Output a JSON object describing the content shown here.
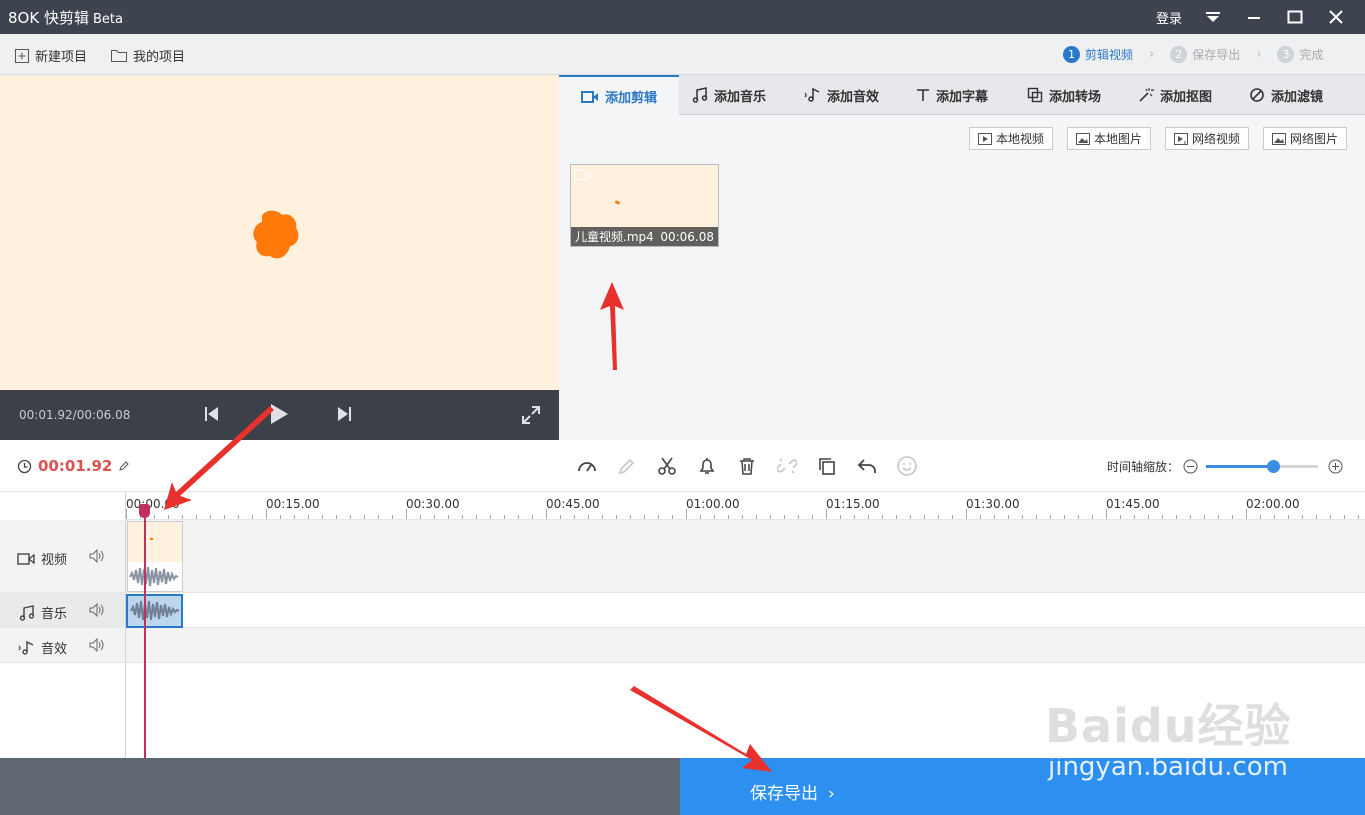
{
  "app": {
    "title": "快剪辑",
    "beta": "Beta",
    "logo_mark": "8OK"
  },
  "window": {
    "login": "登录"
  },
  "toolbar": {
    "new_project": "新建项目",
    "my_projects": "我的项目"
  },
  "steps": [
    {
      "num": "1",
      "label": "剪辑视频",
      "active": true
    },
    {
      "num": "2",
      "label": "保存导出",
      "active": false
    },
    {
      "num": "3",
      "label": "完成",
      "active": false
    }
  ],
  "player": {
    "timecode": "00:01.92/00:06.08"
  },
  "tabs": [
    {
      "label": "添加剪辑",
      "icon": "video-camera-icon",
      "active": true
    },
    {
      "label": "添加音乐",
      "icon": "music-note-icon"
    },
    {
      "label": "添加音效",
      "icon": "sound-effect-icon"
    },
    {
      "label": "添加字幕",
      "icon": "text-icon"
    },
    {
      "label": "添加转场",
      "icon": "transition-icon"
    },
    {
      "label": "添加抠图",
      "icon": "magic-wand-icon"
    },
    {
      "label": "添加滤镜",
      "icon": "filter-icon"
    }
  ],
  "sources": [
    {
      "label": "本地视频"
    },
    {
      "label": "本地图片"
    },
    {
      "label": "网络视频"
    },
    {
      "label": "网络图片"
    }
  ],
  "media": {
    "filename": "儿童视频.mp4",
    "duration": "00:06.08"
  },
  "edit": {
    "current_time": "00:01.92",
    "zoom_label": "时间轴缩放：",
    "zoom_level": 0.6
  },
  "ruler": [
    "00:00.00",
    "00:15.00",
    "00:30.00",
    "00:45.00",
    "01:00.00",
    "01:15.00",
    "01:30.00",
    "01:45.00",
    "02:00.00"
  ],
  "tracks": [
    {
      "label": "视频"
    },
    {
      "label": "音乐"
    },
    {
      "label": "音效"
    }
  ],
  "bottom": {
    "export": "保存导出"
  },
  "watermark": {
    "brand": "Baidu经验",
    "url": "jingyan.baidu.com"
  },
  "colors": {
    "accent": "#2a78c8",
    "export_bg": "#2d8ff0",
    "playhead": "#c0305a",
    "time": "#d9534f"
  }
}
